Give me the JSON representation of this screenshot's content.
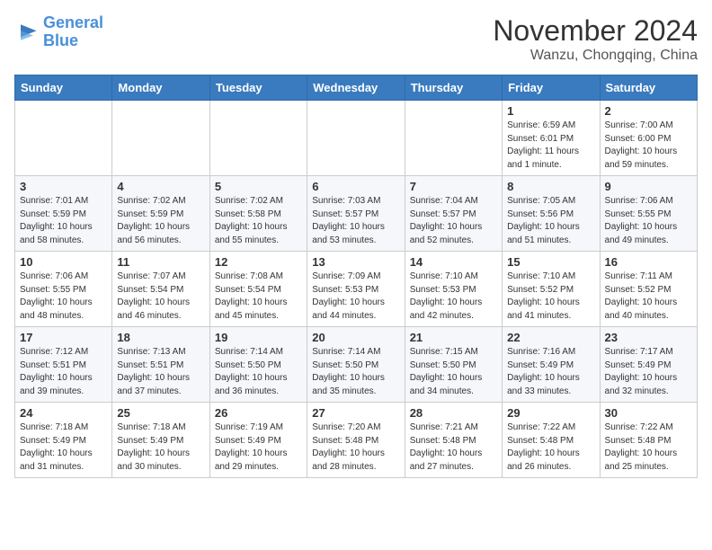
{
  "logo": {
    "line1": "General",
    "line2": "Blue"
  },
  "title": "November 2024",
  "subtitle": "Wanzu, Chongqing, China",
  "days_header": [
    "Sunday",
    "Monday",
    "Tuesday",
    "Wednesday",
    "Thursday",
    "Friday",
    "Saturday"
  ],
  "weeks": [
    [
      {
        "num": "",
        "info": ""
      },
      {
        "num": "",
        "info": ""
      },
      {
        "num": "",
        "info": ""
      },
      {
        "num": "",
        "info": ""
      },
      {
        "num": "",
        "info": ""
      },
      {
        "num": "1",
        "info": "Sunrise: 6:59 AM\nSunset: 6:01 PM\nDaylight: 11 hours\nand 1 minute."
      },
      {
        "num": "2",
        "info": "Sunrise: 7:00 AM\nSunset: 6:00 PM\nDaylight: 10 hours\nand 59 minutes."
      }
    ],
    [
      {
        "num": "3",
        "info": "Sunrise: 7:01 AM\nSunset: 5:59 PM\nDaylight: 10 hours\nand 58 minutes."
      },
      {
        "num": "4",
        "info": "Sunrise: 7:02 AM\nSunset: 5:59 PM\nDaylight: 10 hours\nand 56 minutes."
      },
      {
        "num": "5",
        "info": "Sunrise: 7:02 AM\nSunset: 5:58 PM\nDaylight: 10 hours\nand 55 minutes."
      },
      {
        "num": "6",
        "info": "Sunrise: 7:03 AM\nSunset: 5:57 PM\nDaylight: 10 hours\nand 53 minutes."
      },
      {
        "num": "7",
        "info": "Sunrise: 7:04 AM\nSunset: 5:57 PM\nDaylight: 10 hours\nand 52 minutes."
      },
      {
        "num": "8",
        "info": "Sunrise: 7:05 AM\nSunset: 5:56 PM\nDaylight: 10 hours\nand 51 minutes."
      },
      {
        "num": "9",
        "info": "Sunrise: 7:06 AM\nSunset: 5:55 PM\nDaylight: 10 hours\nand 49 minutes."
      }
    ],
    [
      {
        "num": "10",
        "info": "Sunrise: 7:06 AM\nSunset: 5:55 PM\nDaylight: 10 hours\nand 48 minutes."
      },
      {
        "num": "11",
        "info": "Sunrise: 7:07 AM\nSunset: 5:54 PM\nDaylight: 10 hours\nand 46 minutes."
      },
      {
        "num": "12",
        "info": "Sunrise: 7:08 AM\nSunset: 5:54 PM\nDaylight: 10 hours\nand 45 minutes."
      },
      {
        "num": "13",
        "info": "Sunrise: 7:09 AM\nSunset: 5:53 PM\nDaylight: 10 hours\nand 44 minutes."
      },
      {
        "num": "14",
        "info": "Sunrise: 7:10 AM\nSunset: 5:53 PM\nDaylight: 10 hours\nand 42 minutes."
      },
      {
        "num": "15",
        "info": "Sunrise: 7:10 AM\nSunset: 5:52 PM\nDaylight: 10 hours\nand 41 minutes."
      },
      {
        "num": "16",
        "info": "Sunrise: 7:11 AM\nSunset: 5:52 PM\nDaylight: 10 hours\nand 40 minutes."
      }
    ],
    [
      {
        "num": "17",
        "info": "Sunrise: 7:12 AM\nSunset: 5:51 PM\nDaylight: 10 hours\nand 39 minutes."
      },
      {
        "num": "18",
        "info": "Sunrise: 7:13 AM\nSunset: 5:51 PM\nDaylight: 10 hours\nand 37 minutes."
      },
      {
        "num": "19",
        "info": "Sunrise: 7:14 AM\nSunset: 5:50 PM\nDaylight: 10 hours\nand 36 minutes."
      },
      {
        "num": "20",
        "info": "Sunrise: 7:14 AM\nSunset: 5:50 PM\nDaylight: 10 hours\nand 35 minutes."
      },
      {
        "num": "21",
        "info": "Sunrise: 7:15 AM\nSunset: 5:50 PM\nDaylight: 10 hours\nand 34 minutes."
      },
      {
        "num": "22",
        "info": "Sunrise: 7:16 AM\nSunset: 5:49 PM\nDaylight: 10 hours\nand 33 minutes."
      },
      {
        "num": "23",
        "info": "Sunrise: 7:17 AM\nSunset: 5:49 PM\nDaylight: 10 hours\nand 32 minutes."
      }
    ],
    [
      {
        "num": "24",
        "info": "Sunrise: 7:18 AM\nSunset: 5:49 PM\nDaylight: 10 hours\nand 31 minutes."
      },
      {
        "num": "25",
        "info": "Sunrise: 7:18 AM\nSunset: 5:49 PM\nDaylight: 10 hours\nand 30 minutes."
      },
      {
        "num": "26",
        "info": "Sunrise: 7:19 AM\nSunset: 5:49 PM\nDaylight: 10 hours\nand 29 minutes."
      },
      {
        "num": "27",
        "info": "Sunrise: 7:20 AM\nSunset: 5:48 PM\nDaylight: 10 hours\nand 28 minutes."
      },
      {
        "num": "28",
        "info": "Sunrise: 7:21 AM\nSunset: 5:48 PM\nDaylight: 10 hours\nand 27 minutes."
      },
      {
        "num": "29",
        "info": "Sunrise: 7:22 AM\nSunset: 5:48 PM\nDaylight: 10 hours\nand 26 minutes."
      },
      {
        "num": "30",
        "info": "Sunrise: 7:22 AM\nSunset: 5:48 PM\nDaylight: 10 hours\nand 25 minutes."
      }
    ]
  ]
}
